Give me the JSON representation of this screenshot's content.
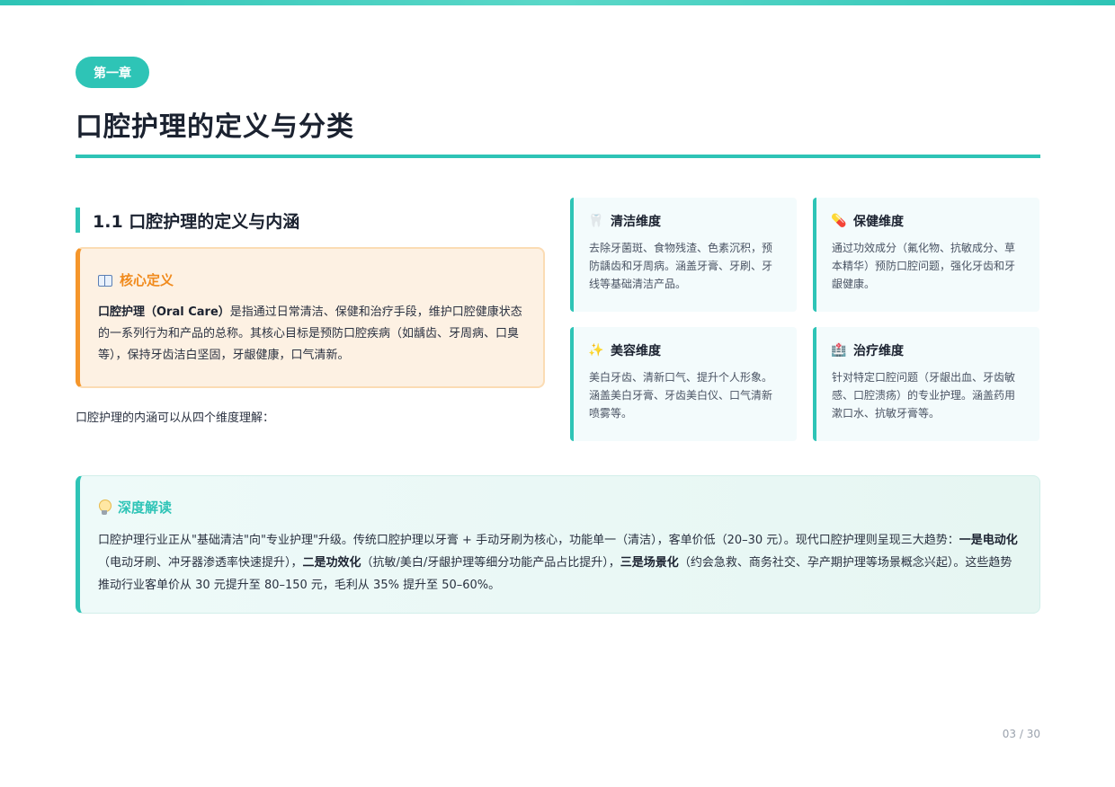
{
  "chapter_badge": "第一章",
  "page_title": "口腔护理的定义与分类",
  "section": {
    "heading": "1.1 口腔护理的定义与内涵"
  },
  "definition": {
    "title": "核心定义",
    "icon": "book-icon",
    "term": "口腔护理（Oral Care）",
    "body": "是指通过日常清洁、保健和治疗手段，维护口腔健康状态的一系列行为和产品的总称。其核心目标是预防口腔疾病（如龋齿、牙周病、口臭等），保持牙齿洁白坚固，牙龈健康，口气清新。"
  },
  "intro": "口腔护理的内涵可以从四个维度理解：",
  "dimensions": [
    {
      "icon": "tooth-icon",
      "glyph": "🦷",
      "title": "清洁维度",
      "text": "去除牙菌斑、食物残渣、色素沉积，预防龋齿和牙周病。涵盖牙膏、牙刷、牙线等基础清洁产品。"
    },
    {
      "icon": "pill-icon",
      "glyph": "💊",
      "title": "保健维度",
      "text": "通过功效成分（氟化物、抗敏成分、草本精华）预防口腔问题，强化牙齿和牙龈健康。"
    },
    {
      "icon": "sparkles-icon",
      "glyph": "✨",
      "title": "美容维度",
      "text": "美白牙齿、清新口气、提升个人形象。涵盖美白牙膏、牙齿美白仪、口气清新喷雾等。"
    },
    {
      "icon": "hospital-icon",
      "glyph": "🏥",
      "title": "治疗维度",
      "text": "针对特定口腔问题（牙龈出血、牙齿敏感、口腔溃疡）的专业护理。涵盖药用漱口水、抗敏牙膏等。"
    }
  ],
  "insight": {
    "title": "深度解读",
    "icon": "lightbulb-icon",
    "parts": [
      {
        "bold": false,
        "text": "口腔护理行业正从\"基础清洁\"向\"专业护理\"升级。传统口腔护理以牙膏 + 手动牙刷为核心，功能单一（清洁），客单价低（20–30 元）。现代口腔护理则呈现三大趋势："
      },
      {
        "bold": true,
        "text": "一是电动化"
      },
      {
        "bold": false,
        "text": "（电动牙刷、冲牙器渗透率快速提升），"
      },
      {
        "bold": true,
        "text": "二是功效化"
      },
      {
        "bold": false,
        "text": "（抗敏/美白/牙龈护理等细分功能产品占比提升），"
      },
      {
        "bold": true,
        "text": "三是场景化"
      },
      {
        "bold": false,
        "text": "（约会急救、商务社交、孕产期护理等场景概念兴起）。这些趋势推动行业客单价从 30 元提升至 80–150 元，毛利从 35% 提升至 50–60%。"
      }
    ]
  },
  "page_number": "03 / 30",
  "colors": {
    "accent": "#2ec4b6",
    "orange": "#f5962b",
    "title": "#1b2230"
  }
}
